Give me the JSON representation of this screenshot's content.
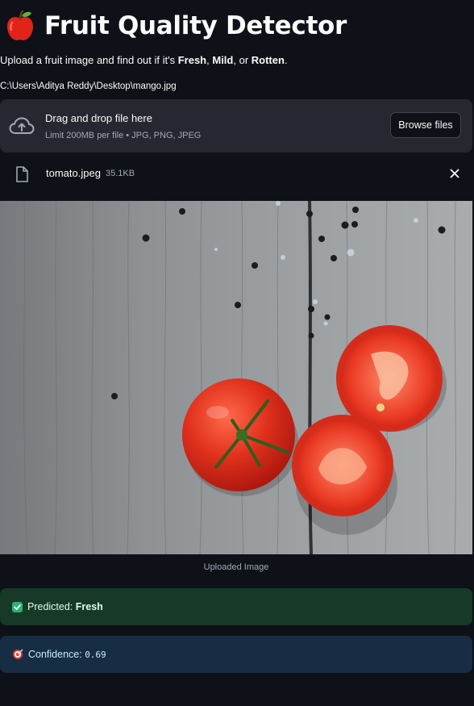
{
  "header": {
    "title": "Fruit Quality Detector",
    "title_icon": "red-apple-emoji"
  },
  "intro": {
    "text_before": "Upload a fruit image and find out if it's ",
    "fresh": "Fresh",
    "comma": ", ",
    "mild": "Mild",
    "or": ", or ",
    "rotten": "Rotten",
    "period": "."
  },
  "path_text": "C:\\Users\\Aditya Reddy\\Desktop\\mango.jpg",
  "uploader": {
    "icon": "cloud-upload-icon",
    "title": "Drag and drop file here",
    "limit": "Limit 200MB per file • JPG, PNG, JPEG",
    "browse_label": "Browse files"
  },
  "file": {
    "icon": "file-icon",
    "name": "tomato.jpeg",
    "size": "35.1KB"
  },
  "image_caption": "Uploaded Image",
  "prediction": {
    "icon": "check-icon",
    "label": "Predicted: ",
    "value": "Fresh"
  },
  "confidence": {
    "icon": "target-icon",
    "label": "Confidence: ",
    "value": "0.69"
  },
  "colors": {
    "background": "#0e1117",
    "uploader_bg": "#262730",
    "success_bg": "#173928",
    "info_bg": "#172d43"
  }
}
